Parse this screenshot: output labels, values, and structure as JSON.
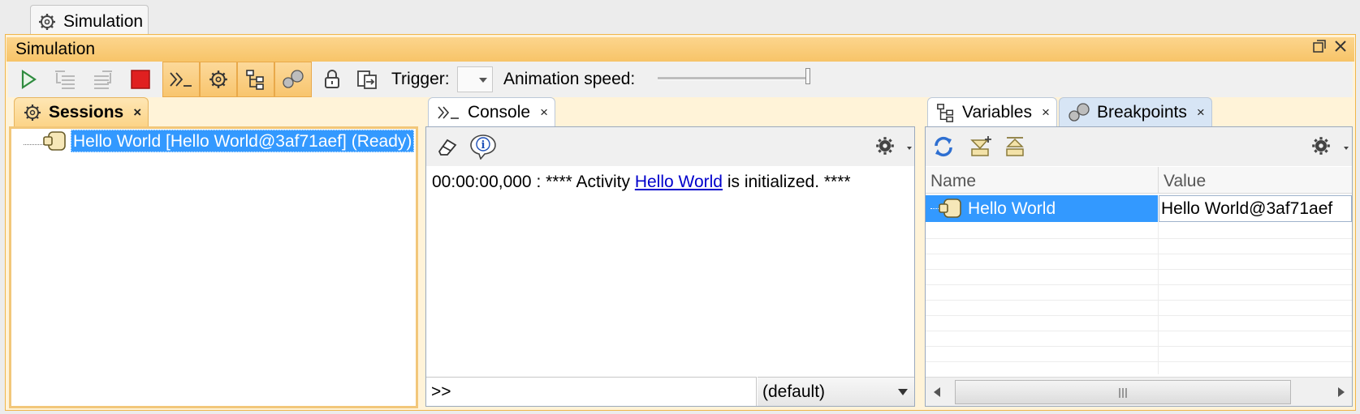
{
  "window": {
    "tab_title": "Simulation",
    "panel_title": "Simulation"
  },
  "toolbar": {
    "trigger_label": "Trigger:",
    "trigger_value": "",
    "animation_speed_label": "Animation speed:",
    "animation_speed": 1.0
  },
  "sessions": {
    "tab_label": "Sessions",
    "close": "×",
    "items": [
      {
        "label": "Hello World [Hello World@3af71aef] (Ready)"
      }
    ]
  },
  "console": {
    "tab_label": "Console",
    "close": "×",
    "log": {
      "prefix": "00:00:00,000 : **** Activity ",
      "link": "Hello World",
      "suffix": " is initialized. ****"
    },
    "input_prompt": ">>",
    "context_select": "(default)"
  },
  "variables": {
    "tab_label": "Variables",
    "close": "×",
    "columns": [
      "Name",
      "Value"
    ],
    "rows": [
      {
        "name": "Hello World",
        "value": "Hello World@3af71aef"
      }
    ]
  },
  "breakpoints": {
    "tab_label": "Breakpoints",
    "close": "×"
  },
  "colors": {
    "accent": "#f8c56e",
    "selection": "#3399ff",
    "link": "#0000cc",
    "stop": "#e02020"
  }
}
